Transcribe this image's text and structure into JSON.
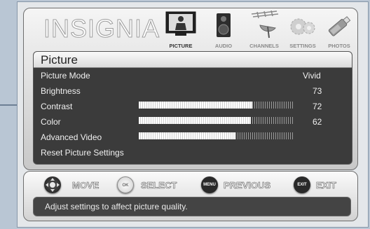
{
  "brand": {
    "logo": "INSIGNIA"
  },
  "tabs": [
    {
      "label": "PICTURE",
      "icon": "tv-icon",
      "active": true
    },
    {
      "label": "AUDIO",
      "icon": "speaker-icon",
      "active": false
    },
    {
      "label": "CHANNELS",
      "icon": "antenna-icon",
      "active": false
    },
    {
      "label": "SETTINGS",
      "icon": "gears-icon",
      "active": false
    },
    {
      "label": "PHOTOS",
      "icon": "usb-drive-icon",
      "active": false
    }
  ],
  "menu": {
    "title": "Picture",
    "items": [
      {
        "label": "Picture Mode",
        "value": "Vivid"
      },
      {
        "label": "Brightness",
        "value": "73",
        "level": 73
      },
      {
        "label": "Contrast",
        "value": "72",
        "level": 72
      },
      {
        "label": "Color",
        "value": "62",
        "level": 62
      },
      {
        "label": "Advanced Video"
      },
      {
        "label": "Reset Picture Settings"
      }
    ]
  },
  "hints": [
    {
      "label": "MOVE",
      "icon": "dpad-icon"
    },
    {
      "label": "SELECT",
      "icon": "ok-enter-icon",
      "icon_text": "OK"
    },
    {
      "label": "PREVIOUS",
      "icon": "menu-button-icon",
      "icon_text": "MENU"
    },
    {
      "label": "EXIT",
      "icon": "exit-button-icon",
      "icon_text": "EXIT"
    }
  ],
  "description": "Adjust settings to affect picture quality.",
  "colors": {
    "accent": "#3b3b3b",
    "bar_fill": "#ffffff",
    "panel": "#e4e7ea"
  }
}
